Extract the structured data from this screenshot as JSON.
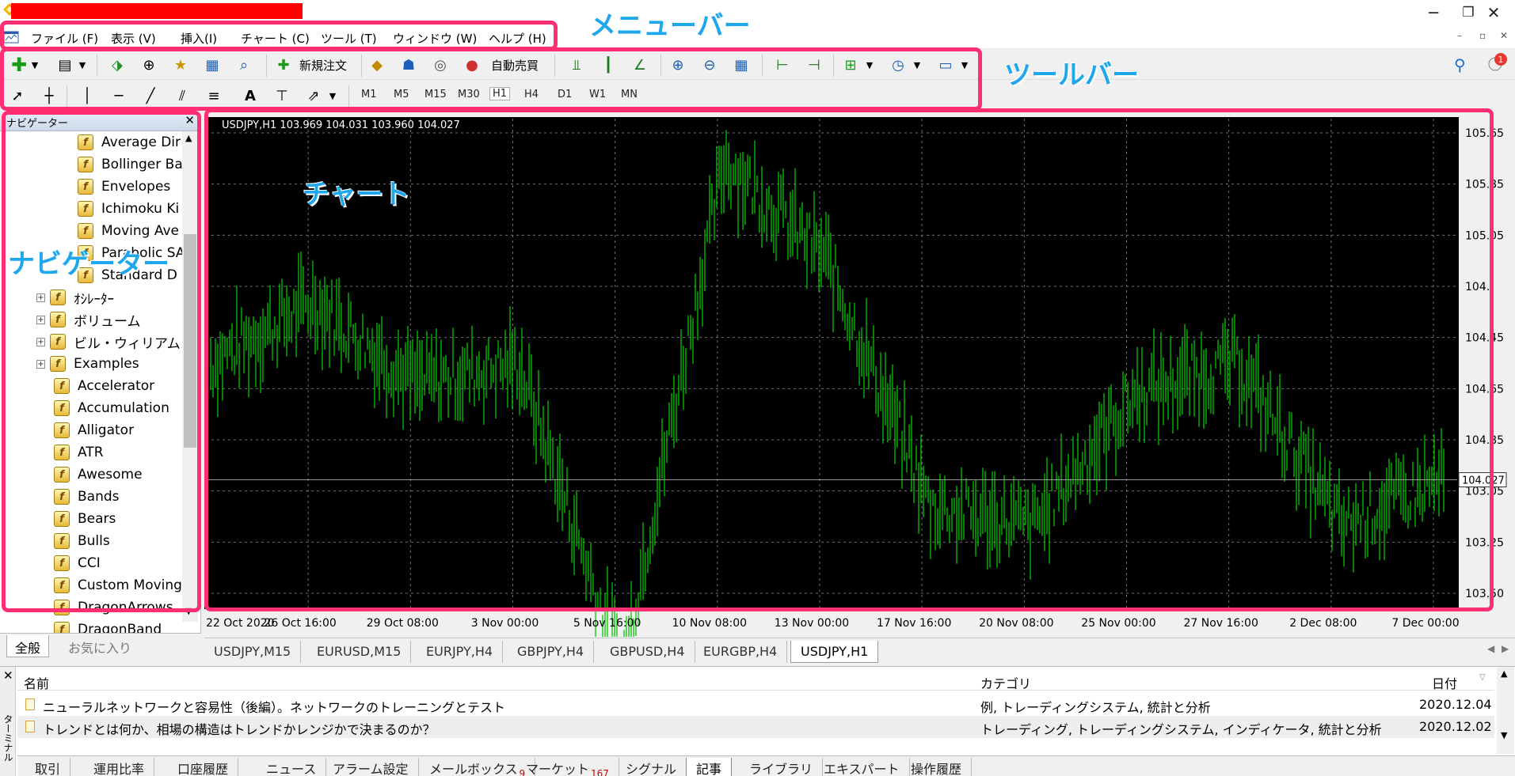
{
  "menubar": {
    "items": [
      "ファイル (F)",
      "表示 (V)",
      "挿入(I)",
      "チャート (C)",
      "ツール (T)",
      "ウィンドウ (W)",
      "ヘルプ (H)"
    ]
  },
  "toolbar": {
    "new_order_label": "新規注文",
    "auto_trade_label": "自動売買",
    "timeframes": [
      "M1",
      "M5",
      "M15",
      "M30",
      "H1",
      "H4",
      "D1",
      "W1",
      "MN"
    ],
    "selected_timeframe": "H1",
    "notification_count": "1"
  },
  "navigator": {
    "title": "ナビゲーター",
    "items": [
      {
        "label": "Average Dir",
        "level": 2
      },
      {
        "label": "Bollinger Ba",
        "level": 2
      },
      {
        "label": "Envelopes",
        "level": 2
      },
      {
        "label": "Ichimoku Ki",
        "level": 2
      },
      {
        "label": "Moving Ave",
        "level": 2
      },
      {
        "label": "Parabolic SA",
        "level": 2
      },
      {
        "label": "Standard D",
        "level": 2
      },
      {
        "label": "ｵｼﾚｰﾀｰ",
        "level": 1,
        "expander": true
      },
      {
        "label": "ボリューム",
        "level": 1,
        "expander": true
      },
      {
        "label": "ビル・ウィリアムス",
        "level": 1,
        "expander": true
      },
      {
        "label": "Examples",
        "level": 1,
        "expander": true
      },
      {
        "label": "Accelerator",
        "level": 1
      },
      {
        "label": "Accumulation",
        "level": 1
      },
      {
        "label": "Alligator",
        "level": 1
      },
      {
        "label": "ATR",
        "level": 1
      },
      {
        "label": "Awesome",
        "level": 1
      },
      {
        "label": "Bands",
        "level": 1
      },
      {
        "label": "Bears",
        "level": 1
      },
      {
        "label": "Bulls",
        "level": 1
      },
      {
        "label": "CCI",
        "level": 1
      },
      {
        "label": "Custom Moving",
        "level": 1
      },
      {
        "label": "DragonArrows",
        "level": 1
      },
      {
        "label": "DragonBand",
        "level": 1
      }
    ],
    "tabs": [
      "全般",
      "お気に入り"
    ]
  },
  "chart": {
    "header": "USDJPY,H1  103.969 104.031 103.960 104.027",
    "current_price": "104.027",
    "price_labels": [
      "105.65",
      "105.85",
      "105.05",
      "104.",
      "104.45",
      "104.65",
      "104.85",
      "103.05",
      "103.25",
      "103.50"
    ],
    "date_labels": [
      "22 Oct 2020",
      "26 Oct 16:00",
      "29 Oct 08:00",
      "3 Nov 00:00",
      "5 Nov 16:00",
      "10 Nov 08:00",
      "13 Nov 00:00",
      "17 Nov 16:00",
      "20 Nov 08:00",
      "25 Nov 00:00",
      "27 Nov 16:00",
      "2 Dec 08:00",
      "7 Dec 00:00"
    ],
    "bar_color": "#00c800",
    "background": "#000000"
  },
  "chart_data": {
    "type": "line",
    "title": "USDJPY,H1",
    "x": [
      "22 Oct 2020",
      "26 Oct 16:00",
      "29 Oct 08:00",
      "3 Nov 00:00",
      "5 Nov 16:00",
      "10 Nov 08:00",
      "13 Nov 00:00",
      "17 Nov 16:00",
      "20 Nov 08:00",
      "25 Nov 00:00",
      "27 Nov 16:00",
      "2 Dec 08:00",
      "7 Dec 00:00"
    ],
    "series": [
      {
        "values": [
          104.6,
          104.9,
          104.5,
          104.6,
          103.1,
          105.6,
          105.1,
          103.9,
          103.8,
          104.45,
          104.6,
          103.8,
          104.03
        ]
      }
    ],
    "ylim": [
      103.4,
      105.8
    ]
  },
  "chart_tabs": [
    "USDJPY,M15",
    "EURUSD,M15",
    "EURJPY,H4",
    "GBPJPY,H4",
    "GBPUSD,H4",
    "EURGBP,H4",
    "USDJPY,H1"
  ],
  "terminal": {
    "side_label": "ターミナル",
    "columns": {
      "name": "名前",
      "category": "カテゴリ",
      "date": "日付"
    },
    "rows": [
      {
        "name": "ニューラルネットワークと容易性（後編）。ネットワークのトレーニングとテスト",
        "category": "例, トレーディングシステム, 統計と分析",
        "date": "2020.12.04"
      },
      {
        "name": "トレンドとは何か、相場の構造はトレンドかレンジかで決まるのか？",
        "category": "トレーディング, トレーディングシステム, インディケータ, 統計と分析",
        "date": "2020.12.02"
      }
    ],
    "tabs": [
      "取引",
      "運用比率",
      "口座履歴",
      "ニュース",
      "アラーム設定",
      "メールボックス",
      "マーケット",
      "シグナル",
      "記事",
      "ライブラリ",
      "エキスパート",
      "操作履歴"
    ],
    "mailbox_count": "9",
    "market_count": "167",
    "active_tab": "記事"
  },
  "annotations": {
    "menubar": "メニューバー",
    "toolbar": "ツールバー",
    "chart": "チャート",
    "navigator": "ナビゲーター"
  }
}
